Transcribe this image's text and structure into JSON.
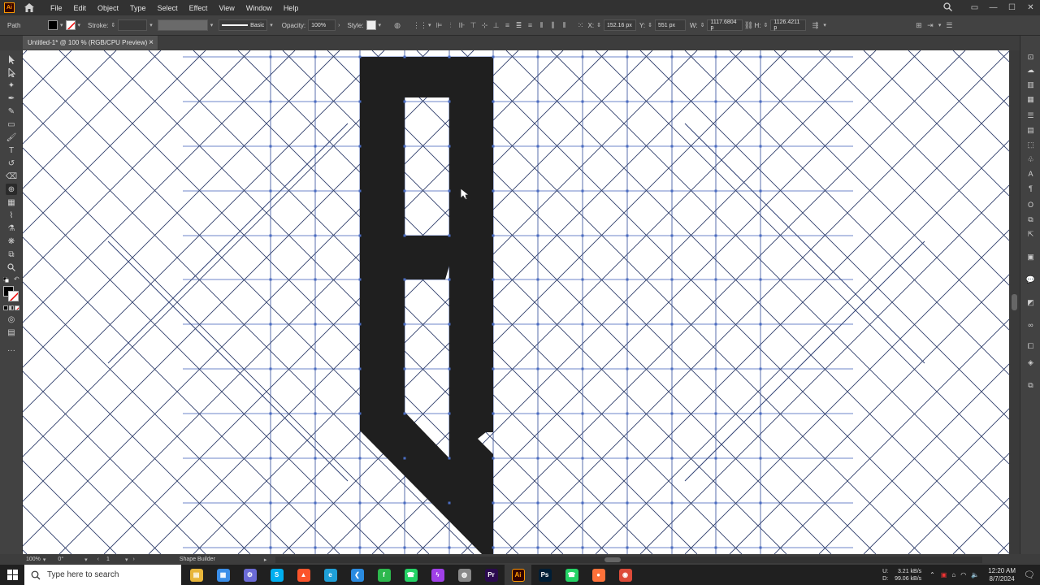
{
  "menubar": {
    "app_badge": "Ai",
    "items": [
      "File",
      "Edit",
      "Object",
      "Type",
      "Select",
      "Effect",
      "View",
      "Window",
      "Help"
    ],
    "window_controls": [
      "—",
      "☐",
      "✕"
    ]
  },
  "controlbar": {
    "selection_label": "Path",
    "stroke_label": "Stroke:",
    "brush_label": "Basic",
    "opacity_label": "Opacity:",
    "opacity_value": "100%",
    "style_label": "Style:",
    "x_label": "X:",
    "x_value": "152.16 px",
    "y_label": "Y:",
    "y_value": "551 px",
    "w_label": "W:",
    "w_value": "1117.6804 p",
    "h_label": "H:",
    "h_value": "1126.4211 p"
  },
  "document": {
    "tab_title": "Untitled-1* @ 100 % (RGB/CPU Preview)",
    "tab_close": "×"
  },
  "statusbar": {
    "zoom": "100%",
    "rotation": "0°",
    "artboard": "1",
    "current_tool": "Shape Builder"
  },
  "taskbar": {
    "search_placeholder": "Type here to search",
    "net_up": "3.21 kB/s",
    "net_down": "99.06 kB/s",
    "net_up_label": "U:",
    "net_down_label": "D:",
    "time": "12:20 AM",
    "date": "8/7/2024",
    "apps": [
      {
        "name": "file-explorer-icon",
        "glyph": "▤",
        "color": "#e8b63a"
      },
      {
        "name": "store-icon",
        "glyph": "▦",
        "color": "#3a8ee8"
      },
      {
        "name": "settings-app-icon",
        "glyph": "⚙",
        "color": "#6b6bd6"
      },
      {
        "name": "skype-icon",
        "glyph": "S",
        "color": "#00aff0"
      },
      {
        "name": "brave-icon",
        "glyph": "▲",
        "color": "#fb542b"
      },
      {
        "name": "edge-icon",
        "glyph": "e",
        "color": "#1fa0d8"
      },
      {
        "name": "vscode-icon",
        "glyph": "❮",
        "color": "#2a8be0"
      },
      {
        "name": "green-app-icon",
        "glyph": "f",
        "color": "#2db84d"
      },
      {
        "name": "whatsapp-icon",
        "glyph": "☎",
        "color": "#25d366"
      },
      {
        "name": "messenger-icon",
        "glyph": "ϟ",
        "color": "#a040e8"
      },
      {
        "name": "chrome-dev-icon",
        "glyph": "◍",
        "color": "#888888"
      },
      {
        "name": "premiere-icon",
        "glyph": "Pr",
        "color": "#2b0a4f"
      },
      {
        "name": "illustrator-icon",
        "glyph": "Ai",
        "color": "#330000"
      },
      {
        "name": "photoshop-icon",
        "glyph": "Ps",
        "color": "#001e36"
      },
      {
        "name": "whatsapp-2-icon",
        "glyph": "☎",
        "color": "#25d366"
      },
      {
        "name": "firefox-icon",
        "glyph": "●",
        "color": "#ff7139"
      },
      {
        "name": "chrome-icon",
        "glyph": "◉",
        "color": "#dd4b39"
      }
    ]
  },
  "colors": {
    "fill": "#000000",
    "artwork": "#1f1f1f",
    "guide": "#4a6cc2",
    "active_app": "#ff9a00"
  }
}
